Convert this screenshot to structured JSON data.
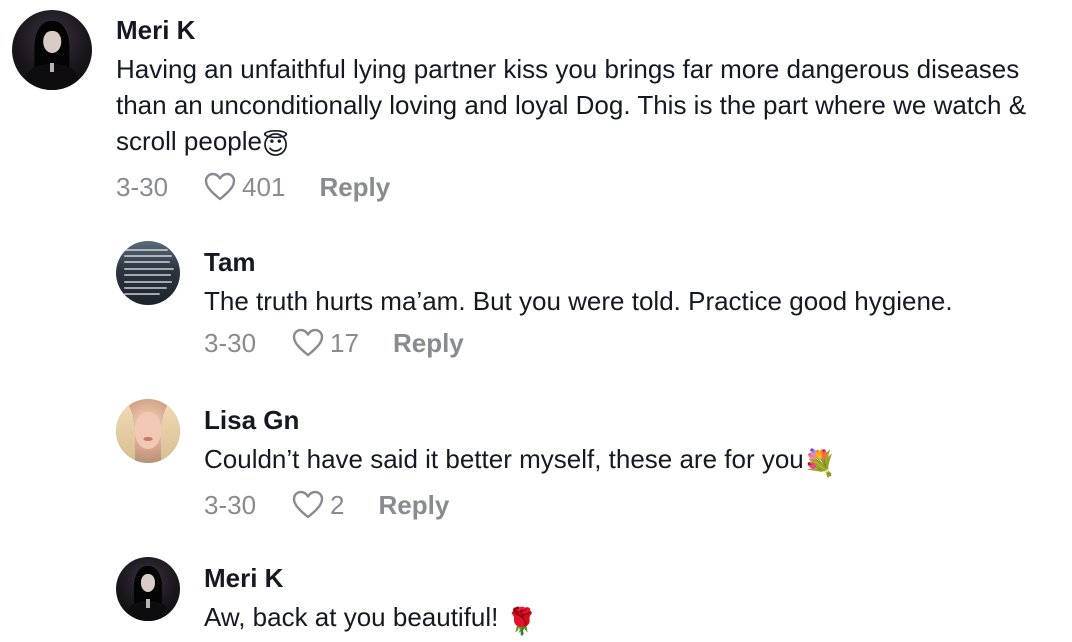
{
  "comments": [
    {
      "username": "Meri K",
      "text": "Having an unfaithful lying partner kiss you brings far more dangerous diseases than an unconditionally loving and loyal Dog. This is the part where we watch & scroll people",
      "emoji": "😇",
      "date": "3-30",
      "likes": "401",
      "reply_label": "Reply"
    },
    {
      "username": "Tam",
      "text": "The truth hurts ma’am. But you were told. Practice good hygiene.",
      "date": "3-30",
      "likes": "17",
      "reply_label": "Reply"
    },
    {
      "username": "Lisa Gn",
      "text": "Couldn’t have said it better myself, these are for you",
      "emoji": "💐",
      "date": "3-30",
      "likes": "2",
      "reply_label": "Reply"
    },
    {
      "username": "Meri K",
      "text": "Aw, back at you beautiful! ",
      "emoji": "🌹"
    }
  ],
  "icons": {
    "like": "heart-outline-icon"
  },
  "colors": {
    "text_primary": "#161823",
    "text_secondary": "#8a8b91",
    "background": "#ffffff"
  }
}
